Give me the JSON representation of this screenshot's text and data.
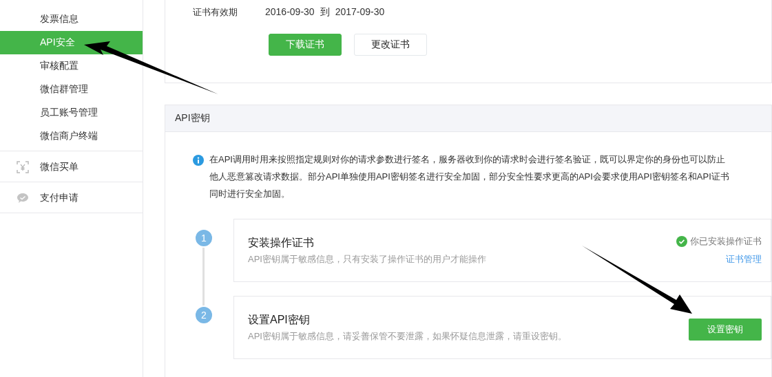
{
  "sidebar": {
    "sections": [
      {
        "items": [
          {
            "label": "发票信息",
            "selected": false
          },
          {
            "label": "API安全",
            "selected": true
          },
          {
            "label": "审核配置",
            "selected": false
          },
          {
            "label": "微信群管理",
            "selected": false
          },
          {
            "label": "员工账号管理",
            "selected": false
          },
          {
            "label": "微信商户终端",
            "selected": false
          }
        ]
      },
      {
        "items": [
          {
            "label": "微信买单",
            "selected": false,
            "kind": "scan"
          }
        ]
      },
      {
        "items": [
          {
            "label": "支付申请",
            "selected": false,
            "kind": "chat"
          }
        ]
      }
    ]
  },
  "certificate": {
    "validity_label": "证书有效期",
    "start": "2016-09-30",
    "separator": "到",
    "end": "2017-09-30",
    "buttons": [
      {
        "label": "下载证书",
        "kind": "primary"
      },
      {
        "label": "更改证书",
        "kind": "default"
      }
    ]
  },
  "api_key": {
    "title": "API密钥",
    "info_lines": [
      "在API调用时用来按照指定规则对你的请求参数进行签名，服务器收到你的请求时会进行签名验证，既可以界定你的身份也可以防止",
      "他人恶意篡改请求数据。部分API单独使用API密钥签名进行安全加固，部分安全性要求更高的API会要求使用API密钥签名和API证书",
      "同时进行安全加固。"
    ],
    "steps": [
      {
        "number": "1",
        "title": "安装操作证书",
        "description": "API密钥属于敏感信息，只有安装了操作证书的用户才能操作",
        "kind": "status",
        "status": "你已安装操作证书",
        "link": "证书管理"
      },
      {
        "number": "2",
        "title": "设置API密钥",
        "description": "API密钥属于敏感信息，请妥善保管不要泄露，如果怀疑信息泄露，请重设密钥。",
        "kind": "action",
        "action": "设置密钥"
      }
    ]
  }
}
